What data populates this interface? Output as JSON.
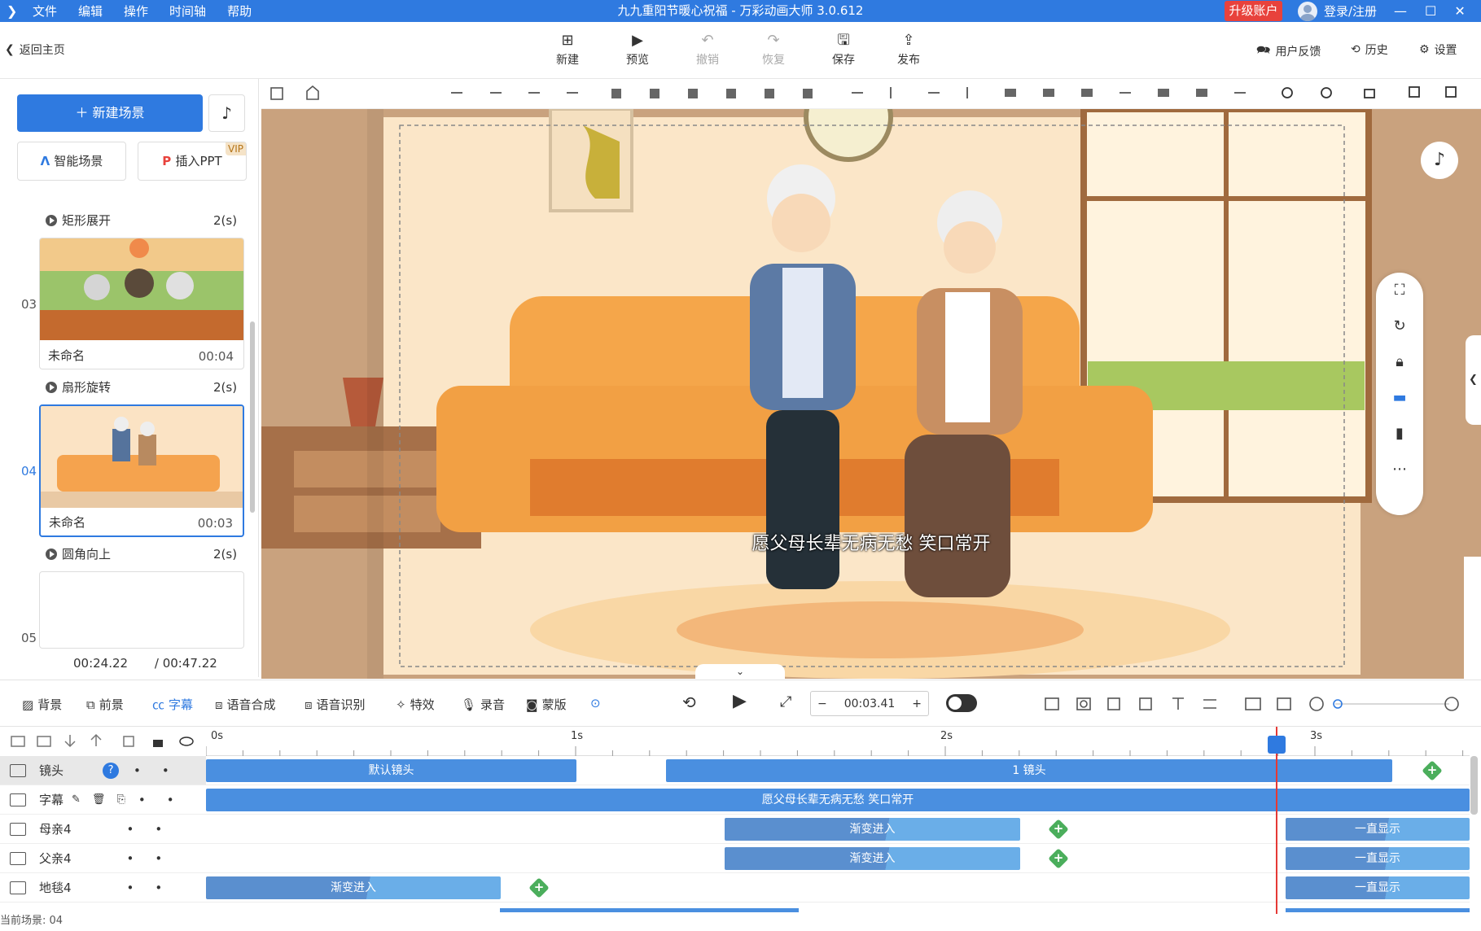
{
  "titlebar": {
    "menu": [
      "文件",
      "编辑",
      "操作",
      "时间轴",
      "帮助"
    ],
    "title": "九九重阳节暖心祝福 - 万彩动画大师 3.0.612",
    "upgrade": "升级账户",
    "login": "登录/注册"
  },
  "toolbar": {
    "back": "返回主页",
    "new": "新建",
    "preview": "预览",
    "undo": "撤销",
    "redo": "恢复",
    "save": "保存",
    "publish": "发布",
    "feedback": "用户反馈",
    "history": "历史",
    "settings": "设置"
  },
  "left": {
    "new_scene": "新建场景",
    "smart_scene": "智能场景",
    "insert_ppt": "插入PPT",
    "vip": "VIP",
    "scenes": [
      {
        "transition": "矩形展开",
        "trans_dur": "2(s)",
        "num": "03",
        "name": "未命名",
        "time": "00:04"
      },
      {
        "transition": "扇形旋转",
        "trans_dur": "2(s)",
        "num": "04",
        "name": "未命名",
        "time": "00:03"
      },
      {
        "transition": "圆角向上",
        "trans_dur": "2(s)",
        "num": "05",
        "name": "",
        "time": ""
      }
    ],
    "current_time": "00:24.22",
    "total_time": "/ 00:47.22"
  },
  "canvas": {
    "subtitle": "愿父母长辈无病无愁 笑口常开"
  },
  "bottombar": {
    "items": [
      "背景",
      "前景",
      "字幕",
      "语音合成",
      "语音识别",
      "特效",
      "录音",
      "蒙版"
    ],
    "active": "字幕",
    "timecode": "00:03.41"
  },
  "timeline": {
    "ruler": [
      "0s",
      "1s",
      "2s",
      "3s"
    ],
    "tracks": [
      {
        "name": "镜头"
      },
      {
        "name": "字幕"
      },
      {
        "name": "母亲4"
      },
      {
        "name": "父亲4"
      },
      {
        "name": "地毯4"
      }
    ],
    "clips": {
      "lens_default": "默认镜头",
      "lens_1": "1 镜头",
      "subtitle": "愿父母长辈无病无愁 笑口常开",
      "fade_in": "渐变进入",
      "always": "一直显示"
    },
    "current_scene": "当前场景: 04"
  },
  "colors": {
    "accent": "#2f7ae0",
    "upgrade": "#e8423c",
    "playhead": "#e53935",
    "keyframe": "#4bae5c"
  }
}
